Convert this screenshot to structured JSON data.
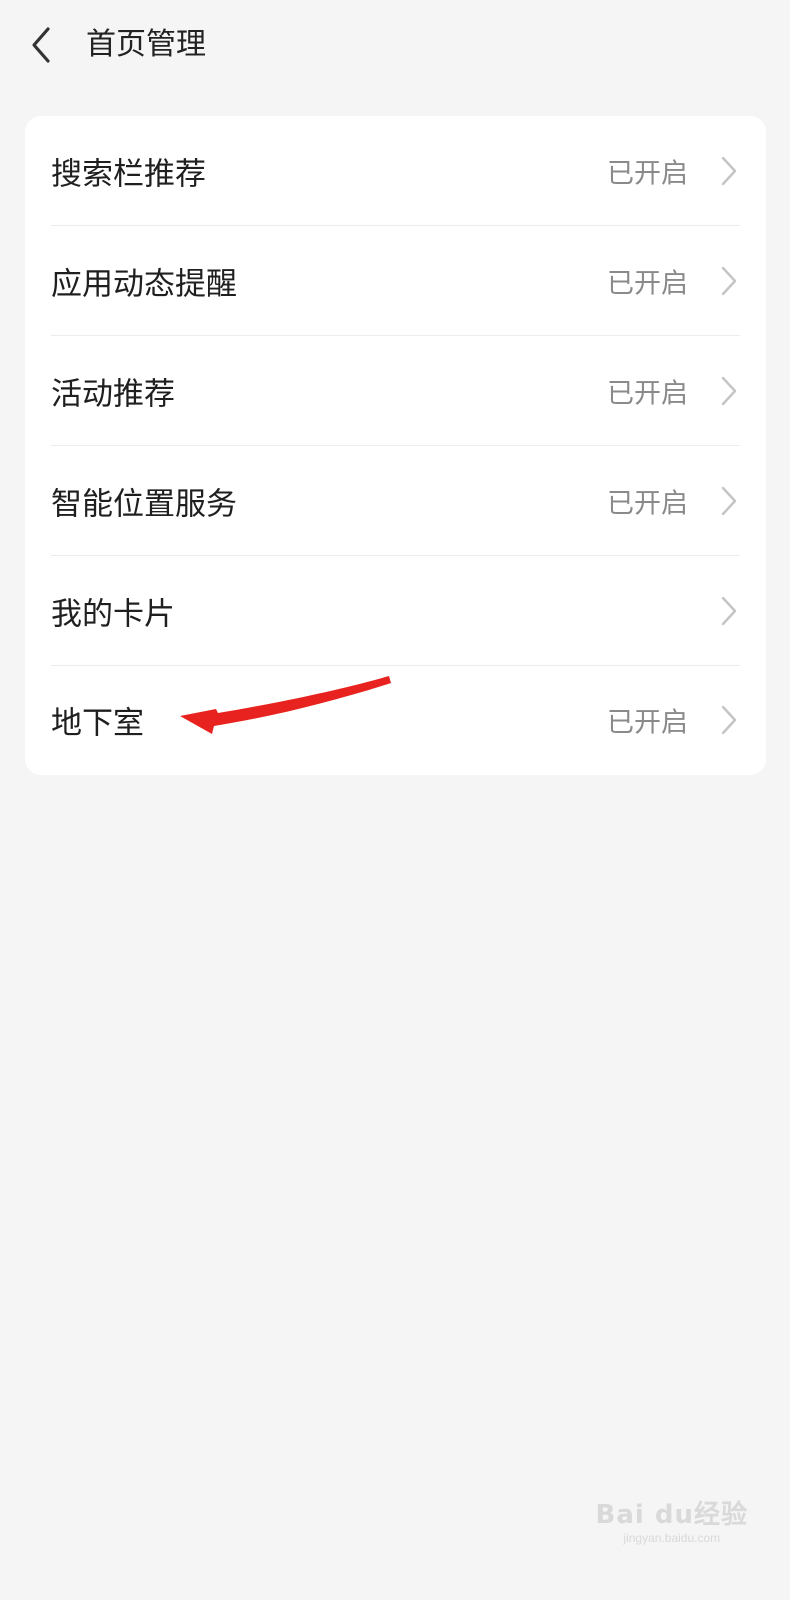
{
  "header": {
    "back_icon": "chevron-left-icon",
    "title": "首页管理"
  },
  "settings": {
    "items": [
      {
        "label": "搜索栏推荐",
        "status": "已开启"
      },
      {
        "label": "应用动态提醒",
        "status": "已开启"
      },
      {
        "label": "活动推荐",
        "status": "已开启"
      },
      {
        "label": "智能位置服务",
        "status": "已开启"
      },
      {
        "label": "我的卡片",
        "status": ""
      },
      {
        "label": "地下室",
        "status": "已开启"
      }
    ],
    "chevron_icon": "chevron-right-icon"
  },
  "annotation": {
    "icon": "red-arrow-icon",
    "color": "#e8231f"
  },
  "watermark": {
    "brand": "Bai du经验",
    "url": "jingyan.baidu.com"
  },
  "colors": {
    "background": "#f5f5f5",
    "card": "#ffffff",
    "text_primary": "#1f1f1f",
    "text_secondary": "#8a8a8a"
  }
}
